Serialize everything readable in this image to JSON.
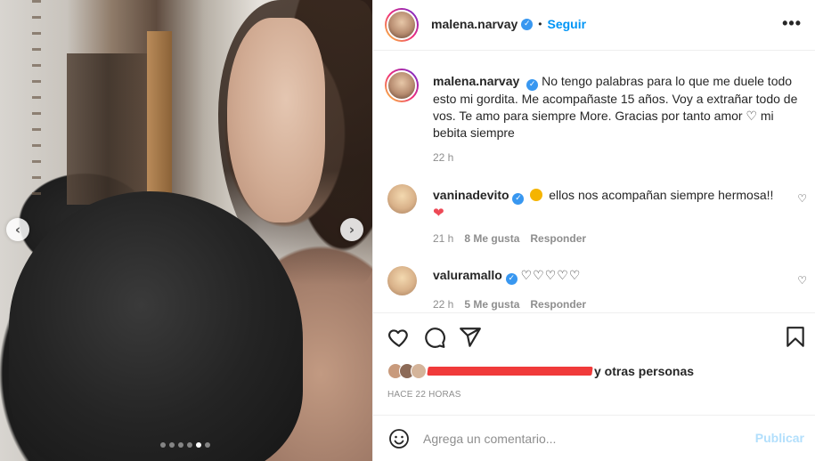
{
  "post": {
    "author": "malena.narvay",
    "follow_label": "Seguir",
    "separator": "•",
    "more_label": "•••",
    "caption": "No tengo palabras para lo que me duele todo esto mi gordita. Me acompañaste 15 años. Voy a extrañar todo de vos. Te amo para siempre More. Gracias por tanto amor ♡ mi bebita siempre",
    "caption_time": "22 h"
  },
  "carousel": {
    "prev_label": "‹",
    "next_label": "›",
    "dots_total": 6,
    "dots_active_index": 4
  },
  "comments": [
    {
      "username": "vaninadevito",
      "text": "ellos nos acompañan siempre hermosa!!",
      "heart": "❤",
      "time": "21 h",
      "likes": "8 Me gusta",
      "reply": "Responder"
    },
    {
      "username": "valuramallo",
      "text": "♡♡♡♡♡",
      "time": "22 h",
      "likes": "5 Me gusta",
      "reply": "Responder"
    }
  ],
  "likes_summary": {
    "text": "y otras personas"
  },
  "timestamp_label": "HACE 22 HORAS",
  "add_comment": {
    "placeholder": "Agrega un comentario...",
    "post_label": "Publicar"
  },
  "colors": {
    "accent": "#0095f6",
    "verified": "#3897f0",
    "heart_red": "#ed4956",
    "muted": "#8e8e8e",
    "redaction": "#f03a3a"
  },
  "icons": {
    "like": "heart-outline-icon",
    "comment": "comment-bubble-icon",
    "share": "paper-plane-icon",
    "save": "bookmark-icon",
    "emoji": "smiley-icon",
    "comment_like": "small-heart-icon",
    "verified": "verified-badge-icon"
  }
}
